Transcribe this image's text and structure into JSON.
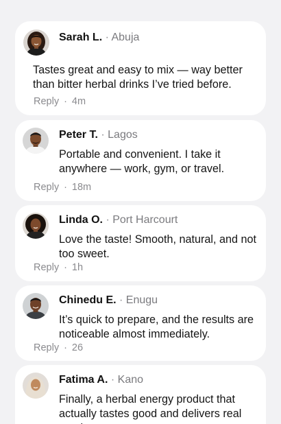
{
  "comments": [
    {
      "name": "Sarah L.",
      "separator": "·",
      "location": "Abuja",
      "text": "Tastes great and easy to mix — way better than bitter herbal drinks I’ve tried before.",
      "reply_label": "Reply",
      "dot": "·",
      "time": "4m",
      "avatar_icon": "woman-portrait-avatar"
    },
    {
      "name": "Peter T.",
      "separator": "·",
      "location": "Lagos",
      "text": "Portable and convenient. I take it anywhere — work, gym, or travel.",
      "reply_label": "Reply",
      "dot": "·",
      "time": "18m",
      "avatar_icon": "man-portrait-avatar"
    },
    {
      "name": "Linda O.",
      "separator": "·",
      "location": "Port Harcourt",
      "text": "Love the taste! Smooth, natural, and not too sweet.",
      "reply_label": "Reply",
      "dot": "·",
      "time": "1h",
      "avatar_icon": "woman-portrait-avatar"
    },
    {
      "name": "Chinedu E.",
      "separator": "·",
      "location": "Enugu",
      "text": "It’s quick to prepare, and the results are noticeable almost immediately.",
      "reply_label": "Reply",
      "dot": "·",
      "time": "26",
      "avatar_icon": "man-portrait-avatar"
    },
    {
      "name": "Fatima A.",
      "separator": "·",
      "location": "Kano",
      "text": "Finally, a herbal energy product that actually tastes good and delivers real results.",
      "avatar_icon": "woman-hijab-portrait-avatar"
    }
  ]
}
